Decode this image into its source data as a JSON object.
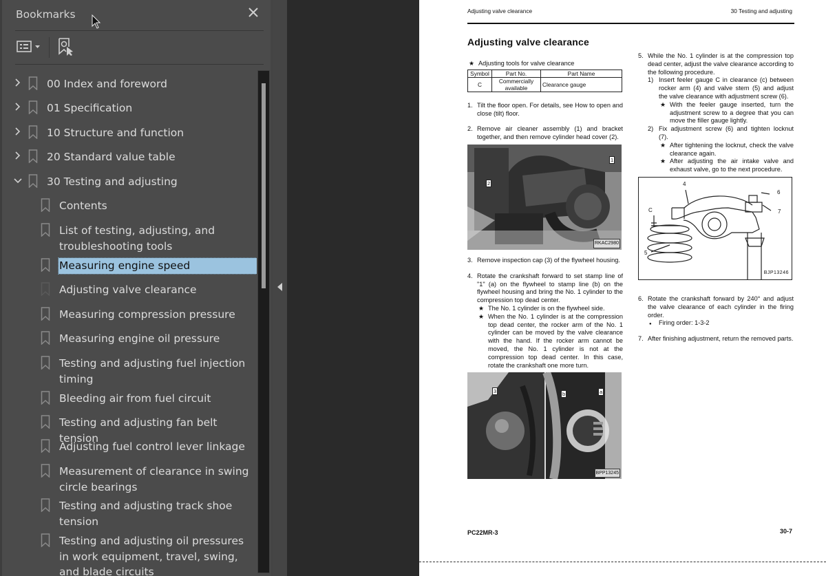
{
  "sidebar": {
    "title": "Bookmarks",
    "close_icon": "close-icon",
    "toolbar": {
      "options_icon": "list-options-icon",
      "find_icon": "find-current-bookmark-icon"
    },
    "items": [
      {
        "label": "00 Index and foreword",
        "level": 0,
        "expanded": false
      },
      {
        "label": "01 Specification",
        "level": 0,
        "expanded": false
      },
      {
        "label": "10 Structure and function",
        "level": 0,
        "expanded": false
      },
      {
        "label": "20 Standard value table",
        "level": 0,
        "expanded": false
      },
      {
        "label": "30 Testing and adjusting",
        "level": 0,
        "expanded": true
      },
      {
        "label": "Contents",
        "level": 1
      },
      {
        "label": "List of testing, adjusting, and troubleshooting tools",
        "level": 1
      },
      {
        "label": "Measuring engine speed",
        "level": 1,
        "selected": true
      },
      {
        "label": "Adjusting valve clearance",
        "level": 1,
        "current": true
      },
      {
        "label": "Measuring compression pressure",
        "level": 1
      },
      {
        "label": "Measuring engine oil pressure",
        "level": 1
      },
      {
        "label": "Testing and adjusting fuel injection timing",
        "level": 1
      },
      {
        "label": "Bleeding air from fuel circuit",
        "level": 1
      },
      {
        "label": "Testing and adjusting fan belt tension",
        "level": 1
      },
      {
        "label": "Adjusting fuel control lever linkage",
        "level": 1
      },
      {
        "label": "Measurement of clearance in swing circle bearings",
        "level": 1
      },
      {
        "label": "Testing and adjusting track shoe tension",
        "level": 1
      },
      {
        "label": "Testing and adjusting oil pressures in work equipment, travel, swing, and blade circuits",
        "level": 1
      }
    ],
    "colors": {
      "selected_bg": "#9bc3df",
      "panel_bg": "#4b4b4b"
    }
  },
  "document": {
    "header_left": "Adjusting valve clearance",
    "header_right": "30 Testing and adjusting",
    "title": "Adjusting valve clearance",
    "tools_caption": "Adjusting tools for valve clearance",
    "tools_table": {
      "headers": [
        "Symbol",
        "Part No.",
        "Part Name"
      ],
      "rows": [
        [
          "C",
          "Commercially available",
          "Clearance gauge"
        ]
      ]
    },
    "steps": {
      "s1": {
        "n": "1.",
        "text": "Tilt the floor open.  For details, see How to open and close (tilt) floor."
      },
      "s2": {
        "n": "2.",
        "text": "Remove air cleaner assembly (1) and bracket together, and then remove cylinder head cover (2)."
      },
      "s3": {
        "n": "3.",
        "text": "Remove inspection cap (3) of the flywheel housing."
      },
      "s4": {
        "n": "4.",
        "text": "Rotate the crankshaft forward to set stamp line of \"1\" (a) on the flywheel to stamp line (b) on the flywheel housing and bring the No. 1 cylinder to the compression top dead center.",
        "notes": [
          "The No. 1 cylinder is on the flywheel side.",
          "When the No. 1 cylinder is at the compression top dead center, the rocker arm of the No. 1 cylinder can be moved by the valve clearance with the hand.  If the rocker arm cannot be moved, the No. 1 cylinder is not at the compression top dead center. In this case, rotate the crankshaft one more turn."
        ]
      },
      "s5": {
        "n": "5.",
        "text": "While the No. 1 cylinder is at the compression top dead center, adjust the valve clearance according to the following procedure.",
        "sub1": {
          "n": "1)",
          "text": "Insert feeler gauge C in clearance (c) between rocker arm (4) and valve stem (5) and adjust the valve clearance with adjustment screw (6).",
          "note": "With the feeler gauge inserted, turn the adjustment screw to a degree that you can move the filler gauge lightly."
        },
        "sub2": {
          "n": "2)",
          "text": "Fix adjustment screw (6) and tighten locknut (7).",
          "notes": [
            "After tightening the locknut, check the valve clearance again.",
            "After adjusting the air intake valve and exhaust valve, go to the next procedure."
          ]
        }
      },
      "s6": {
        "n": "6.",
        "text": "Rotate the crankshaft forward by 240° and adjust the valve clearance of each cylinder in the firing order.",
        "bullet": "Firing order: 1-3-2"
      },
      "s7": {
        "n": "7.",
        "text": "After finishing adjustment, return the removed parts."
      }
    },
    "figures": {
      "photo1": {
        "tags": [
          "1",
          "2"
        ],
        "code": "RKAC2980"
      },
      "photo2": {
        "tags": [
          "3",
          "b",
          "a"
        ],
        "code": "BPP13245"
      },
      "diagram": {
        "labels": [
          "4",
          "6",
          "7",
          "C",
          "5"
        ],
        "code": "BJP13246"
      }
    },
    "footer_left": "PC22MR-3",
    "footer_right": "30-7"
  },
  "icons": {
    "star": "★",
    "bullet": "●"
  }
}
